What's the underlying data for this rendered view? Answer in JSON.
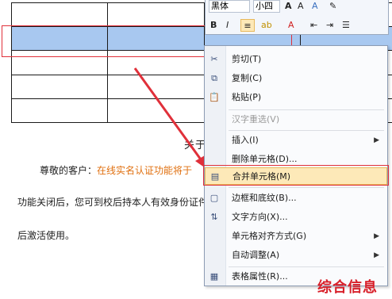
{
  "toolbar": {
    "font_name": "黑体",
    "font_size": "小四",
    "bold": "B",
    "italic": "I",
    "font_color_glyph": "A"
  },
  "document": {
    "heading": "关于",
    "line1_a": "尊敬的客户：",
    "line1_b": "在线实名认证功能将于",
    "line2": "功能关闭后，您可到校后持本人有效身份证件到",
    "line3": "后激活使用。"
  },
  "context_menu": {
    "items": [
      {
        "label": "剪切(T)",
        "icon": "scissors-icon",
        "enabled": true
      },
      {
        "label": "复制(C)",
        "icon": "copy-icon",
        "enabled": true
      },
      {
        "label": "粘贴(P)",
        "icon": "paste-icon",
        "enabled": true
      },
      {
        "label": "汉字重选(V)",
        "icon": "",
        "enabled": false
      },
      {
        "label": "插入(I)",
        "icon": "",
        "enabled": true,
        "submenu": true
      },
      {
        "label": "删除单元格(D)...",
        "icon": "",
        "enabled": true
      },
      {
        "label": "合并单元格(M)",
        "icon": "merge-cells-icon",
        "enabled": true,
        "highlighted": true
      },
      {
        "label": "边框和底纹(B)...",
        "icon": "borders-icon",
        "enabled": true
      },
      {
        "label": "文字方向(X)...",
        "icon": "text-direction-icon",
        "enabled": true
      },
      {
        "label": "单元格对齐方式(G)",
        "icon": "",
        "enabled": true,
        "submenu": true
      },
      {
        "label": "自动调整(A)",
        "icon": "",
        "enabled": true,
        "submenu": true
      },
      {
        "label": "表格属性(R)...",
        "icon": "table-properties-icon",
        "enabled": true
      }
    ]
  },
  "watermark": "综合信息",
  "colors": {
    "selection": "#a8c8f0",
    "annotation_red": "#e0303a",
    "orange_text": "#e07010",
    "menu_hover": "#fde9b8"
  }
}
